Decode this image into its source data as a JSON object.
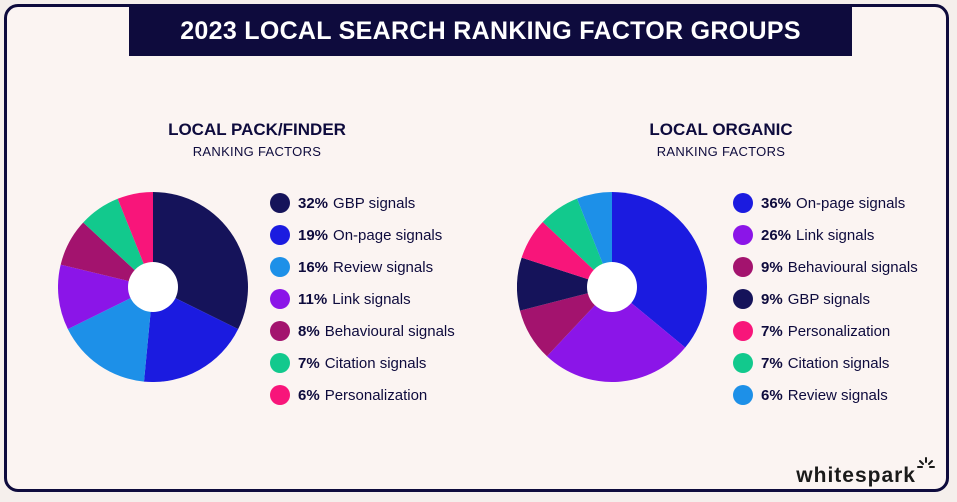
{
  "title": "2023 LOCAL SEARCH RANKING FACTOR GROUPS",
  "logo": "whitespark",
  "chart_data": [
    {
      "type": "pie",
      "title": "LOCAL PACK/FINDER",
      "subtitle": "RANKING FACTORS",
      "slices": [
        {
          "value": 32,
          "label": "32%",
          "name": "GBP signals",
          "color": "#15135a"
        },
        {
          "value": 19,
          "label": "19%",
          "name": "On-page signals",
          "color": "#1b1be0"
        },
        {
          "value": 16,
          "label": "16%",
          "name": "Review signals",
          "color": "#1d90e8"
        },
        {
          "value": 11,
          "label": "11%",
          "name": "Link signals",
          "color": "#8b15e8"
        },
        {
          "value": 8,
          "label": "8%",
          "name": "Behavioural signals",
          "color": "#a3136e"
        },
        {
          "value": 7,
          "label": "7%",
          "name": "Citation signals",
          "color": "#12c98d"
        },
        {
          "value": 6,
          "label": "6%",
          "name": "Personalization",
          "color": "#f8157a"
        }
      ]
    },
    {
      "type": "pie",
      "title": "LOCAL ORGANIC",
      "subtitle": "RANKING FACTORS",
      "slices": [
        {
          "value": 36,
          "label": "36%",
          "name": "On-page signals",
          "color": "#1b1be0"
        },
        {
          "value": 26,
          "label": "26%",
          "name": "Link signals",
          "color": "#8b15e8"
        },
        {
          "value": 9,
          "label": "9%",
          "name": "Behavioural signals",
          "color": "#a3136e"
        },
        {
          "value": 9,
          "label": "9%",
          "name": "GBP signals",
          "color": "#15135a"
        },
        {
          "value": 7,
          "label": "7%",
          "name": "Personalization",
          "color": "#f8157a"
        },
        {
          "value": 7,
          "label": "7%",
          "name": "Citation signals",
          "color": "#12c98d"
        },
        {
          "value": 6,
          "label": "6%",
          "name": "Review signals",
          "color": "#1d90e8"
        }
      ]
    }
  ]
}
